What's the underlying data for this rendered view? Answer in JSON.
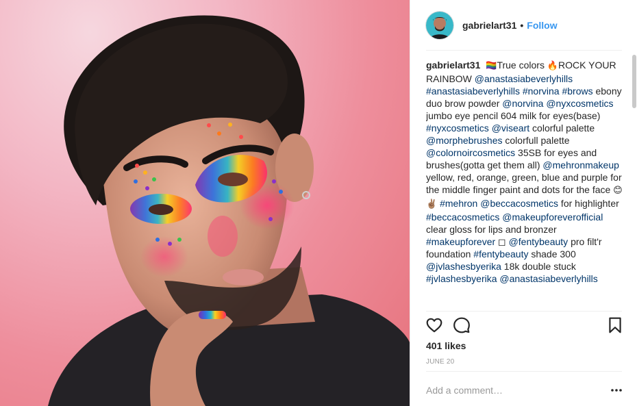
{
  "post": {
    "photo_icon": "portrait-photo",
    "author": {
      "username": "gabrielart31",
      "separator": "•",
      "follow_label": "Follow"
    },
    "caption": {
      "username": "gabrielart31",
      "segments": [
        {
          "type": "emoji",
          "text": "🏳️‍🌈"
        },
        {
          "type": "text",
          "text": "True colors "
        },
        {
          "type": "emoji",
          "text": "🔥"
        },
        {
          "type": "text",
          "text": "ROCK YOUR RAINBOW "
        },
        {
          "type": "tag",
          "text": "@anastasiabeverlyhills"
        },
        {
          "type": "text",
          "text": " "
        },
        {
          "type": "tag",
          "text": "#anastasiabeverlyhills"
        },
        {
          "type": "text",
          "text": " "
        },
        {
          "type": "tag",
          "text": "#norvina"
        },
        {
          "type": "text",
          "text": " "
        },
        {
          "type": "tag",
          "text": "#brows"
        },
        {
          "type": "text",
          "text": " ebony duo brow powder "
        },
        {
          "type": "tag",
          "text": "@norvina"
        },
        {
          "type": "text",
          "text": " "
        },
        {
          "type": "tag",
          "text": "@nyxcosmetics"
        },
        {
          "type": "text",
          "text": " jumbo eye pencil 604 milk for eyes(base) "
        },
        {
          "type": "tag",
          "text": "#nyxcosmetics"
        },
        {
          "type": "text",
          "text": " "
        },
        {
          "type": "tag",
          "text": "@viseart"
        },
        {
          "type": "text",
          "text": " colorful palette "
        },
        {
          "type": "tag",
          "text": "@morphebrushes"
        },
        {
          "type": "text",
          "text": " colorfull palette "
        },
        {
          "type": "tag",
          "text": "@colornoircosmetics"
        },
        {
          "type": "text",
          "text": " 35SB for eyes and brushes(gotta get them all) "
        },
        {
          "type": "tag",
          "text": "@mehronmakeup"
        },
        {
          "type": "text",
          "text": " yellow, red, orange, green, blue and purple for the middle finger paint and dots for the face "
        },
        {
          "type": "emoji",
          "text": "😊✌🏽"
        },
        {
          "type": "text",
          "text": " "
        },
        {
          "type": "tag",
          "text": "#mehron"
        },
        {
          "type": "text",
          "text": " "
        },
        {
          "type": "tag",
          "text": "@beccacosmetics"
        },
        {
          "type": "text",
          "text": " for highlighter "
        },
        {
          "type": "tag",
          "text": "#beccacosmetics"
        },
        {
          "type": "text",
          "text": " "
        },
        {
          "type": "tag",
          "text": "@makeupforeverofficial"
        },
        {
          "type": "text",
          "text": " clear gloss for lips and bronzer "
        },
        {
          "type": "tag",
          "text": "#makeupforever"
        },
        {
          "type": "text",
          "text": " ◻ "
        },
        {
          "type": "tag",
          "text": "@fentybeauty"
        },
        {
          "type": "text",
          "text": " pro filt'r foundation "
        },
        {
          "type": "tag",
          "text": "#fentybeauty"
        },
        {
          "type": "text",
          "text": " shade 300 "
        },
        {
          "type": "tag",
          "text": "@jvlashesbyerika"
        },
        {
          "type": "text",
          "text": " 18k double stuck "
        },
        {
          "type": "tag",
          "text": "#jvlashesbyerika"
        },
        {
          "type": "text",
          "text": " "
        },
        {
          "type": "tag",
          "text": "@anastasiabeverlyhills"
        }
      ]
    },
    "actions": {
      "like_icon": "heart-icon",
      "comment_icon": "comment-icon",
      "save_icon": "bookmark-icon"
    },
    "likes_text": "401 likes",
    "date_text": "JUNE 20",
    "comment": {
      "placeholder": "Add a comment…",
      "value": "",
      "more_icon": "more-options-icon"
    },
    "colors": {
      "text": "#262626",
      "link": "#003569",
      "follow": "#3897f0",
      "muted": "#999999",
      "divider": "#efefef"
    }
  }
}
